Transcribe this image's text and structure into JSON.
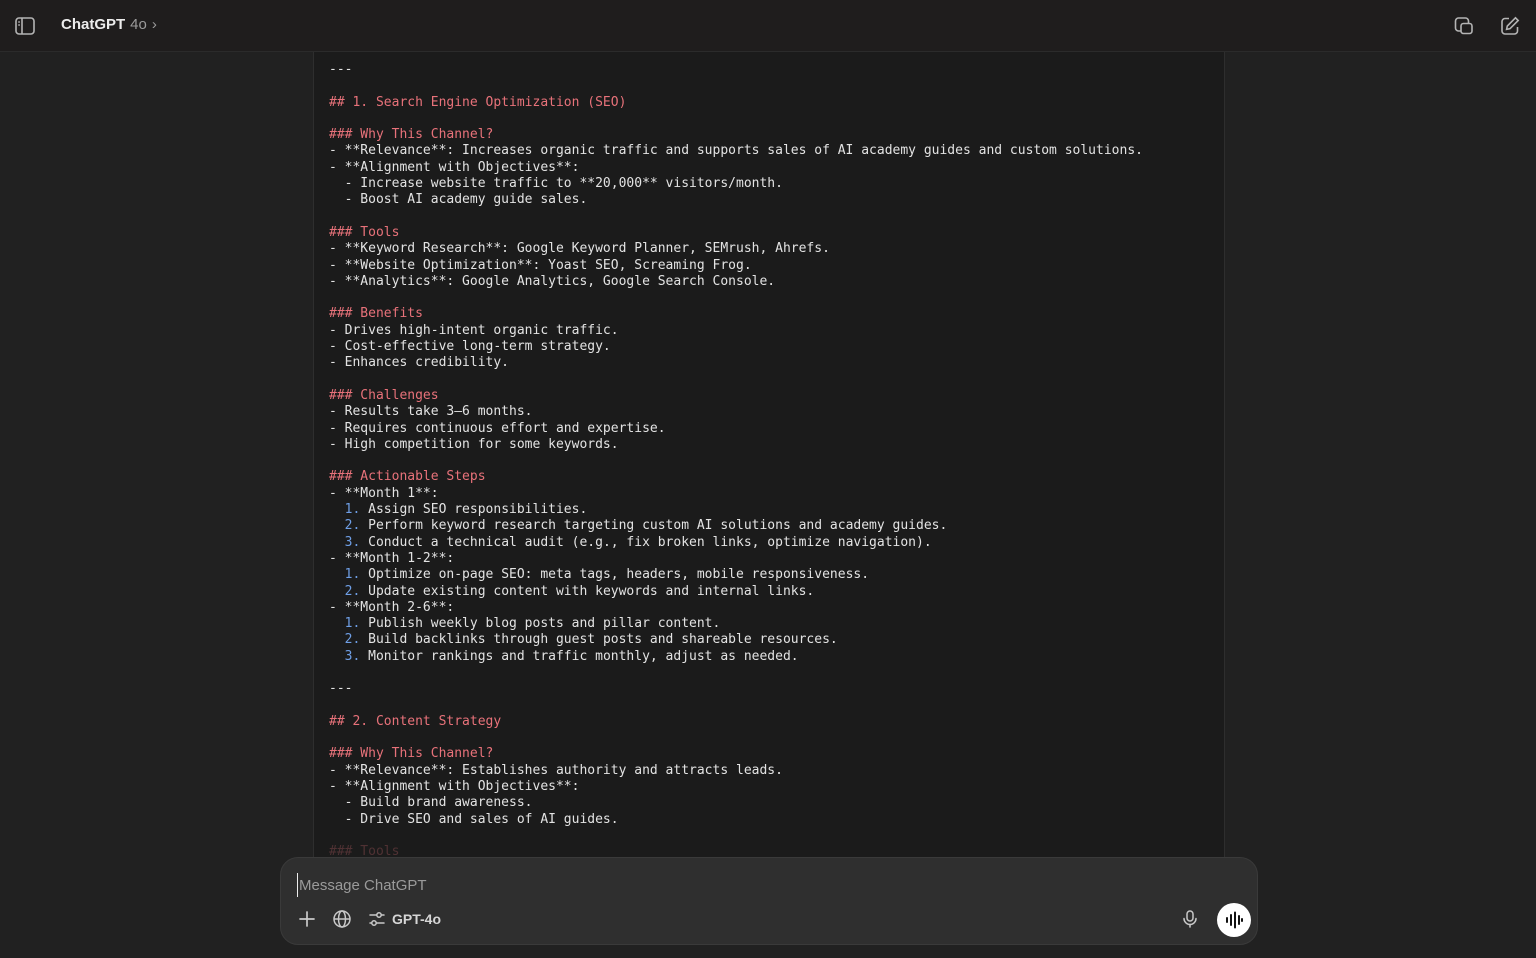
{
  "header": {
    "app_name": "ChatGPT",
    "model": "4o",
    "chevron": "›"
  },
  "icons": {
    "sidebar_toggle": "sidebar-toggle-icon",
    "temporary_chat": "temporary-chat-icon",
    "new_chat": "new-chat-icon",
    "scroll_down": "arrow-down-icon",
    "attach": "plus-icon",
    "search": "globe-icon",
    "tools": "sliders-icon",
    "mic": "microphone-icon",
    "voice": "voice-mode-icon"
  },
  "colors": {
    "heading": "#e8727a",
    "list_number": "#6f9fe6",
    "background": "#212121",
    "document_bg": "#1b1b1b"
  },
  "document": {
    "lines": [
      {
        "t": "---",
        "k": "text"
      },
      {
        "t": "",
        "k": "text"
      },
      {
        "t": "## 1. Search Engine Optimization (SEO)",
        "k": "h"
      },
      {
        "t": "",
        "k": "text"
      },
      {
        "t": "### Why This Channel?",
        "k": "h"
      },
      {
        "t": "- **Relevance**: Increases organic traffic and supports sales of AI academy guides and custom solutions.",
        "k": "text"
      },
      {
        "t": "- **Alignment with Objectives**:",
        "k": "text"
      },
      {
        "t": "  - Increase website traffic to **20,000** visitors/month.",
        "k": "text"
      },
      {
        "t": "  - Boost AI academy guide sales.",
        "k": "text"
      },
      {
        "t": "",
        "k": "text"
      },
      {
        "t": "### Tools",
        "k": "h"
      },
      {
        "t": "- **Keyword Research**: Google Keyword Planner, SEMrush, Ahrefs.",
        "k": "text"
      },
      {
        "t": "- **Website Optimization**: Yoast SEO, Screaming Frog.",
        "k": "text"
      },
      {
        "t": "- **Analytics**: Google Analytics, Google Search Console.",
        "k": "text"
      },
      {
        "t": "",
        "k": "text"
      },
      {
        "t": "### Benefits",
        "k": "h"
      },
      {
        "t": "- Drives high-intent organic traffic.",
        "k": "text"
      },
      {
        "t": "- Cost-effective long-term strategy.",
        "k": "text"
      },
      {
        "t": "- Enhances credibility.",
        "k": "text"
      },
      {
        "t": "",
        "k": "text"
      },
      {
        "t": "### Challenges",
        "k": "h"
      },
      {
        "t": "- Results take 3–6 months.",
        "k": "text"
      },
      {
        "t": "- Requires continuous effort and expertise.",
        "k": "text"
      },
      {
        "t": "- High competition for some keywords.",
        "k": "text"
      },
      {
        "t": "",
        "k": "text"
      },
      {
        "t": "### Actionable Steps",
        "k": "h"
      },
      {
        "t": "- **Month 1**:",
        "k": "text"
      },
      {
        "t": "Assign SEO responsibilities.",
        "k": "num",
        "n": "  1."
      },
      {
        "t": "Perform keyword research targeting custom AI solutions and academy guides.",
        "k": "num",
        "n": "  2."
      },
      {
        "t": "Conduct a technical audit (e.g., fix broken links, optimize navigation).",
        "k": "num",
        "n": "  3."
      },
      {
        "t": "- **Month 1-2**:",
        "k": "text"
      },
      {
        "t": "Optimize on-page SEO: meta tags, headers, mobile responsiveness.",
        "k": "num",
        "n": "  1."
      },
      {
        "t": "Update existing content with keywords and internal links.",
        "k": "num",
        "n": "  2."
      },
      {
        "t": "- **Month 2-6**:",
        "k": "text"
      },
      {
        "t": "Publish weekly blog posts and pillar content.",
        "k": "num",
        "n": "  1."
      },
      {
        "t": "Build backlinks through guest posts and shareable resources.",
        "k": "num",
        "n": "  2."
      },
      {
        "t": "Monitor rankings and traffic monthly, adjust as needed.",
        "k": "num",
        "n": "  3."
      },
      {
        "t": "",
        "k": "text"
      },
      {
        "t": "---",
        "k": "text"
      },
      {
        "t": "",
        "k": "text"
      },
      {
        "t": "## 2. Content Strategy",
        "k": "h"
      },
      {
        "t": "",
        "k": "text"
      },
      {
        "t": "### Why This Channel?",
        "k": "h"
      },
      {
        "t": "- **Relevance**: Establishes authority and attracts leads.",
        "k": "text"
      },
      {
        "t": "- **Alignment with Objectives**:",
        "k": "text"
      },
      {
        "t": "  - Build brand awareness.",
        "k": "text"
      },
      {
        "t": "  - Drive SEO and sales of AI guides.",
        "k": "text"
      },
      {
        "t": "",
        "k": "text"
      },
      {
        "t": "### Tools",
        "k": "h_fade"
      }
    ]
  },
  "composer": {
    "placeholder": "Message ChatGPT",
    "model_button": "GPT-4o"
  }
}
